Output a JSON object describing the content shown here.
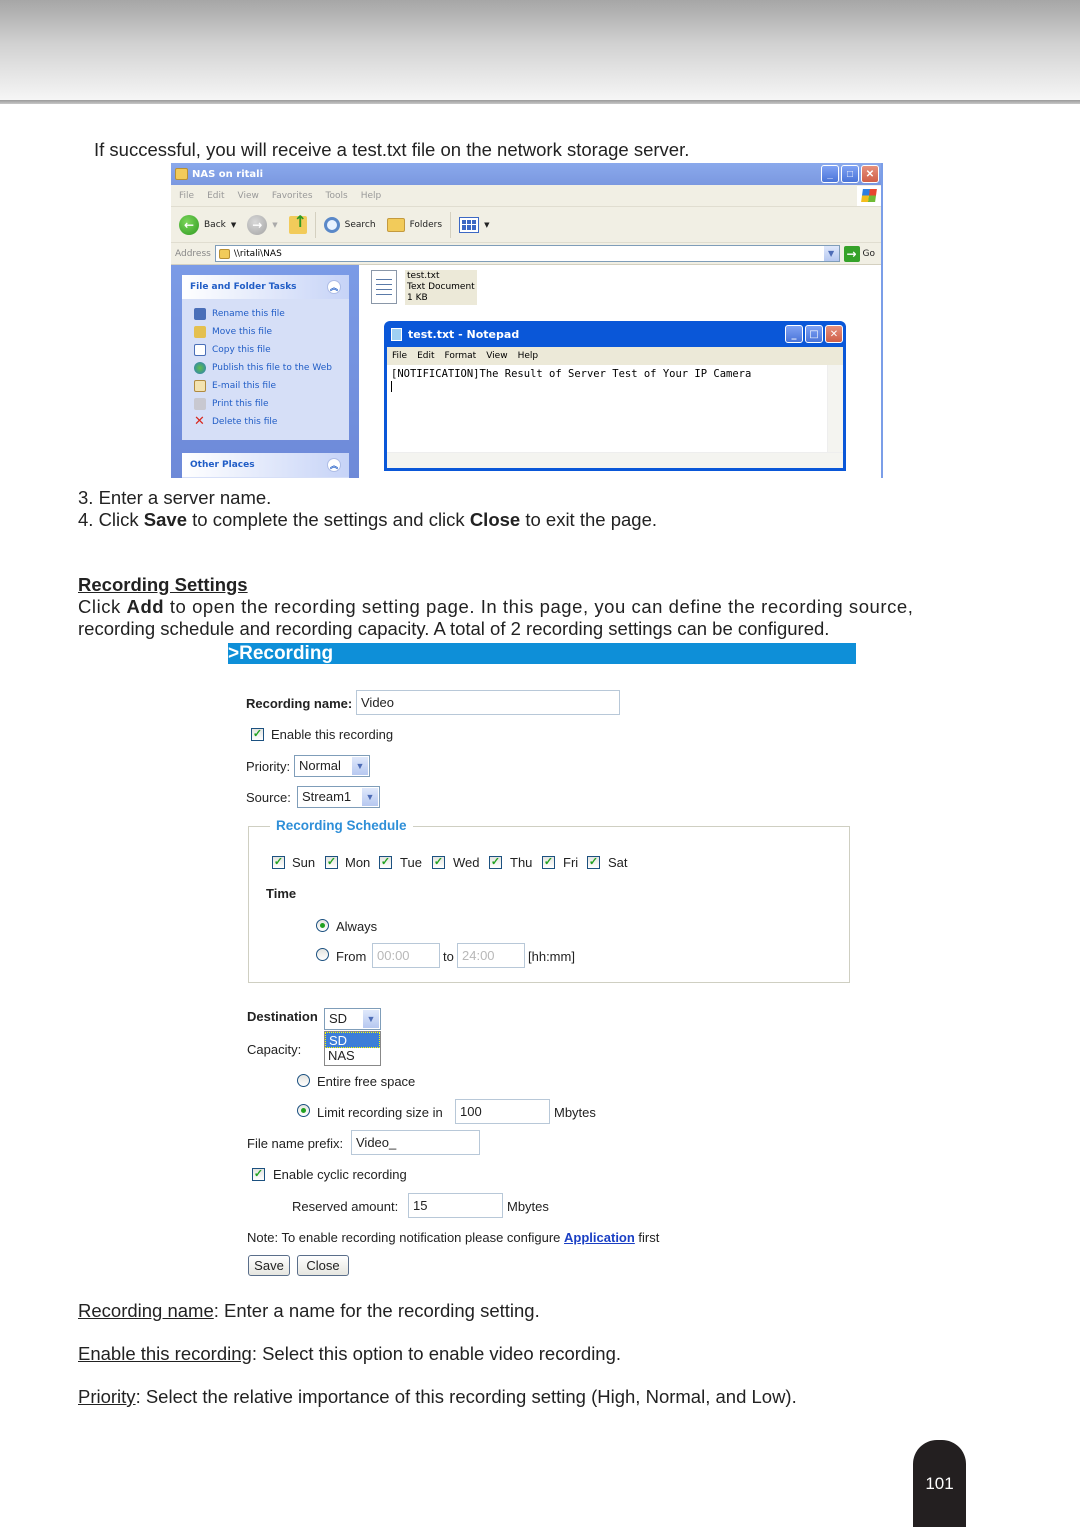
{
  "intro_text": "If successful, you will receive a test.txt file on the network storage server.",
  "explorer": {
    "title": "NAS on ritali",
    "menu": [
      "File",
      "Edit",
      "View",
      "Favorites",
      "Tools",
      "Help"
    ],
    "toolbar": {
      "back": "Back",
      "search": "Search",
      "folders": "Folders"
    },
    "address_label": "Address",
    "address_value": "\\\\ritali\\NAS",
    "go_label": "Go",
    "task_panel": {
      "title": "File and Folder Tasks",
      "items": [
        "Rename this file",
        "Move this file",
        "Copy this file",
        "Publish this file to the Web",
        "E-mail this file",
        "Print this file",
        "Delete this file"
      ]
    },
    "other_places_title": "Other Places",
    "file": {
      "name": "test.txt",
      "type": "Text Document",
      "size": "1 KB"
    }
  },
  "notepad": {
    "title": "test.txt - Notepad",
    "menu": [
      "File",
      "Edit",
      "Format",
      "View",
      "Help"
    ],
    "content": "[NOTIFICATION]The Result of Server Test of Your IP Camera"
  },
  "steps": [
    {
      "pre": "3. Enter a server name.",
      "b1": "",
      "mid": "",
      "b2": "",
      "post": ""
    },
    {
      "pre": "4. Click ",
      "b1": "Save",
      "mid": " to complete the settings and click ",
      "b2": "Close",
      "post": " to exit the page."
    }
  ],
  "section": {
    "heading": "Recording Settings",
    "para_pre": "Click ",
    "para_bold": "Add",
    "para_line1": " to open the recording setting page. In this page, you can define the recording source,",
    "para_line2": "recording schedule and recording capacity. A total of 2 recording settings can be configured."
  },
  "recording_form": {
    "header": ">Recording",
    "name_label": "Recording name:",
    "name_value": "Video",
    "enable_label": "Enable this recording",
    "enable_checked": true,
    "priority_label": "Priority:",
    "priority_value": "Normal",
    "source_label": "Source:",
    "source_value": "Stream1",
    "schedule_legend": "Recording Schedule",
    "days": [
      {
        "label": "Sun",
        "checked": true
      },
      {
        "label": "Mon",
        "checked": true
      },
      {
        "label": "Tue",
        "checked": true
      },
      {
        "label": "Wed",
        "checked": true
      },
      {
        "label": "Thu",
        "checked": true
      },
      {
        "label": "Fri",
        "checked": true
      },
      {
        "label": "Sat",
        "checked": true
      }
    ],
    "time_label": "Time",
    "always_label": "Always",
    "always_selected": true,
    "from_label": "From",
    "from_value": "00:00",
    "to_label": "to",
    "to_value": "24:00",
    "time_format": "[hh:mm]",
    "destination_label": "Destination",
    "destination_value": "SD",
    "destination_options": [
      "SD",
      "NAS"
    ],
    "capacity_label": "Capacity:",
    "entire_label": "Entire free space",
    "limit_label": "Limit recording size in",
    "limit_value": "100",
    "limit_unit": "Mbytes",
    "prefix_label": "File name prefix:",
    "prefix_value": "Video_",
    "cyclic_label": "Enable cyclic recording",
    "reserved_label": "Reserved amount:",
    "reserved_value": "15",
    "reserved_unit": "Mbytes",
    "note_pre": "Note: To enable recording notification please configure ",
    "note_link": "Application",
    "note_post": " first",
    "save_label": "Save",
    "close_label": "Close"
  },
  "descriptions": [
    {
      "term": "Recording name",
      "text": ": Enter a name for the recording setting."
    },
    {
      "term": "Enable this recording",
      "text": ": Select this option to enable video recording."
    },
    {
      "term": "Priority",
      "text": ": Select the relative importance of this recording setting (High, Normal, and Low)."
    }
  ],
  "page_number": "101"
}
